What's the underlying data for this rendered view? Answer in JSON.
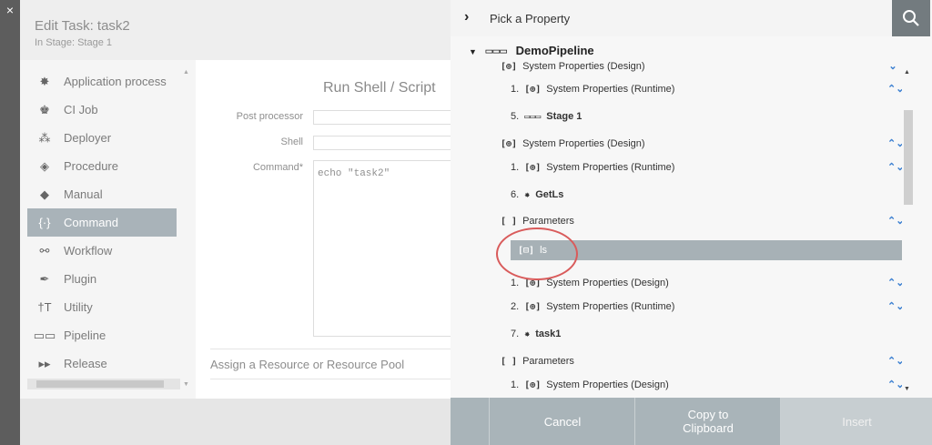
{
  "window": {
    "close_glyph": "×"
  },
  "dialog": {
    "title": "Edit Task: task2",
    "subtitle": "In Stage: Stage 1",
    "task_types": [
      {
        "label": "Application process",
        "icon": "gear-icon",
        "glyph": "✸",
        "active": false
      },
      {
        "label": "CI Job",
        "icon": "ci-job-icon",
        "glyph": "♚",
        "active": false
      },
      {
        "label": "Deployer",
        "icon": "deployer-icon",
        "glyph": "⁂",
        "active": false
      },
      {
        "label": "Procedure",
        "icon": "procedure-icon",
        "glyph": "◈",
        "active": false
      },
      {
        "label": "Manual",
        "icon": "manual-icon",
        "glyph": "◆",
        "active": false
      },
      {
        "label": "Command",
        "icon": "command-icon",
        "glyph": "{·}",
        "active": true
      },
      {
        "label": "Workflow",
        "icon": "workflow-icon",
        "glyph": "⚯",
        "active": false
      },
      {
        "label": "Plugin",
        "icon": "plugin-icon",
        "glyph": "✒",
        "active": false
      },
      {
        "label": "Utility",
        "icon": "utility-icon",
        "glyph": "†T",
        "active": false
      },
      {
        "label": "Pipeline",
        "icon": "pipeline-icon",
        "glyph": "▭▭",
        "active": false
      },
      {
        "label": "Release",
        "icon": "release-icon",
        "glyph": "▸▸",
        "active": false
      }
    ],
    "form": {
      "title": "Run Shell / Script",
      "post_processor_label": "Post processor",
      "post_processor_value": "",
      "shell_label": "Shell",
      "shell_value": "",
      "command_label": "Command*",
      "command_value": "echo \"task2\"",
      "resource_label": "Assign a Resource or Resource Pool"
    }
  },
  "picker": {
    "title": "Pick a Property",
    "search_icon": "search-icon",
    "pipeline_name": "DemoPipeline",
    "rows": [
      {
        "num": "",
        "glyph": "[⊕]",
        "text": "System Properties (Design)",
        "bold": false,
        "exp": "⌄"
      },
      {
        "num": "1.",
        "glyph": "[⊕]",
        "text": "System Properties (Runtime)",
        "bold": false,
        "exp": "⌃⌄"
      },
      {
        "num": "5.",
        "glyph": "▭▭▭",
        "text": "Stage 1",
        "bold": true,
        "exp": ""
      },
      {
        "num": "",
        "glyph": "[⊕]",
        "text": "System Properties (Design)",
        "bold": false,
        "exp": "⌃⌄"
      },
      {
        "num": "1.",
        "glyph": "[⊕]",
        "text": "System Properties (Runtime)",
        "bold": false,
        "exp": "⌃⌄"
      },
      {
        "num": "6.",
        "glyph": "✸",
        "text": "GetLs",
        "bold": true,
        "exp": ""
      },
      {
        "num": "",
        "glyph": "[ ]",
        "text": "Parameters",
        "bold": false,
        "exp": "⌃⌄"
      },
      {
        "num": "",
        "glyph": "[⊟]",
        "text": "ls",
        "bold": false,
        "exp": "",
        "selected": true
      },
      {
        "num": "1.",
        "glyph": "[⊕]",
        "text": "System Properties (Design)",
        "bold": false,
        "exp": "⌃⌄"
      },
      {
        "num": "2.",
        "glyph": "[⊕]",
        "text": "System Properties (Runtime)",
        "bold": false,
        "exp": "⌃⌄"
      },
      {
        "num": "7.",
        "glyph": "✸",
        "text": "task1",
        "bold": true,
        "exp": ""
      },
      {
        "num": "",
        "glyph": "[ ]",
        "text": "Parameters",
        "bold": false,
        "exp": "⌃⌄"
      },
      {
        "num": "1.",
        "glyph": "[⊕]",
        "text": "System Properties (Design)",
        "bold": false,
        "exp": "⌃⌄"
      }
    ],
    "footer": {
      "cancel_label": "Cancel",
      "copy_label_1": "Copy to",
      "copy_label_2": "Clipboard",
      "insert_label": "Insert"
    }
  }
}
